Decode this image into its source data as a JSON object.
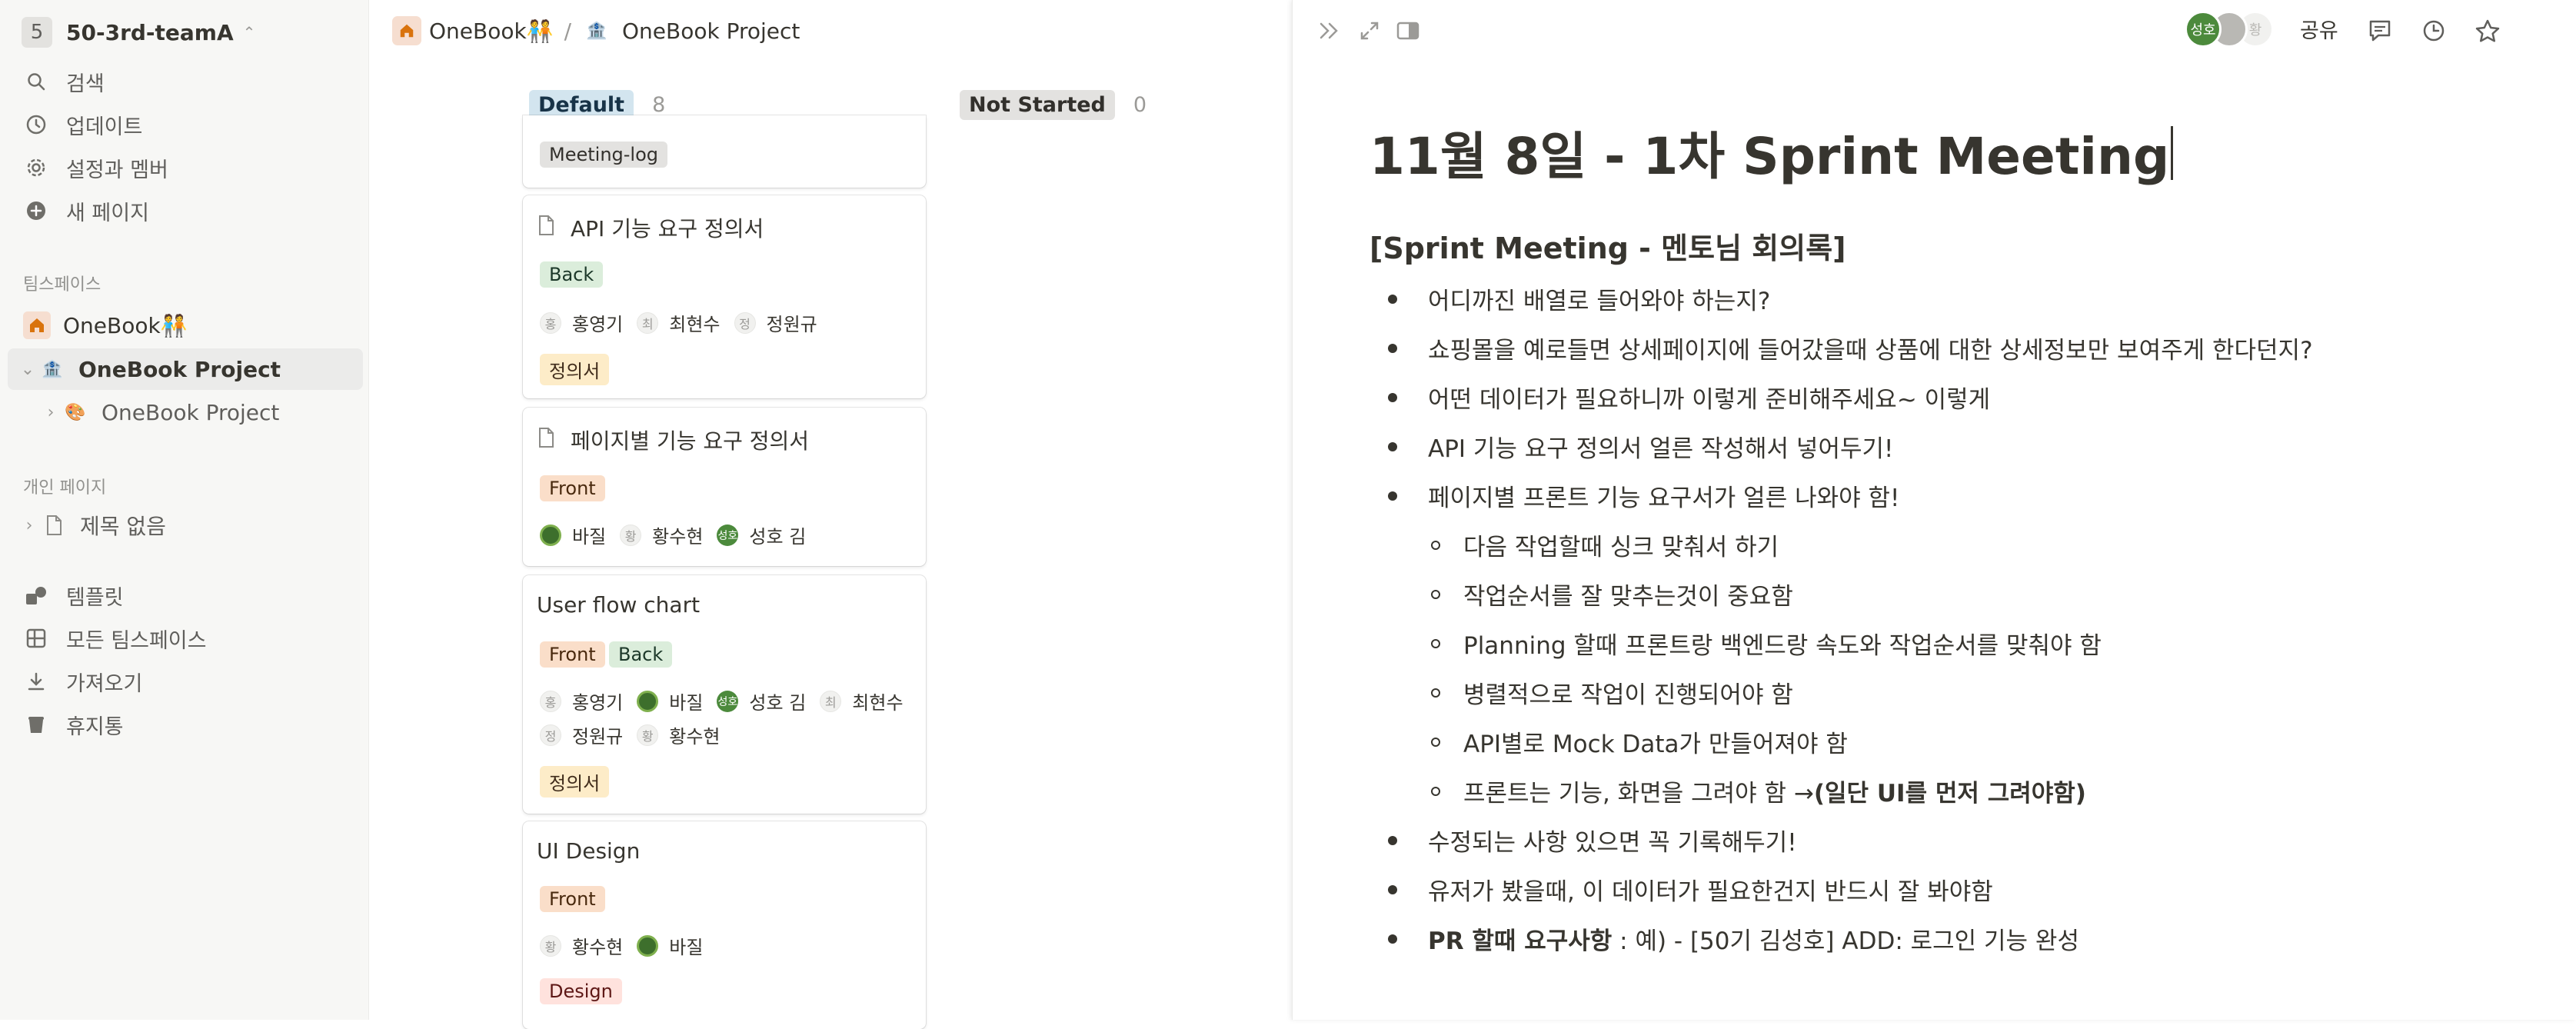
{
  "workspace": {
    "badge": "5",
    "name": "50-3rd-teamA"
  },
  "sidebar": {
    "nav": [
      {
        "label": "검색",
        "icon": "search-icon"
      },
      {
        "label": "업데이트",
        "icon": "clock-icon"
      },
      {
        "label": "설정과 멤버",
        "icon": "gear-icon"
      },
      {
        "label": "새 페이지",
        "icon": "plus-circle-icon"
      }
    ],
    "teamspace_label": "팀스페이스",
    "teamspace_items": [
      {
        "label": "OneBook🧑‍🤝‍🧑",
        "icon": "home-icon"
      },
      {
        "label": "OneBook Project",
        "icon": "bank-emoji"
      },
      {
        "label": "OneBook Project",
        "icon": "palette-emoji"
      }
    ],
    "private_label": "개인 페이지",
    "private_items": [
      {
        "label": "제목 없음",
        "icon": "document-icon"
      }
    ],
    "bottom": [
      {
        "label": "템플릿",
        "icon": "shapes-icon"
      },
      {
        "label": "모든 팀스페이스",
        "icon": "grid-icon"
      },
      {
        "label": "가져오기",
        "icon": "download-icon"
      },
      {
        "label": "휴지통",
        "icon": "trash-icon"
      }
    ]
  },
  "breadcrumb": {
    "first": "OneBook🧑‍🤝‍🧑",
    "sep": "/",
    "second": "OneBook Project"
  },
  "board": {
    "groups": [
      {
        "label": "Default",
        "count": "8",
        "color": "#d3e5ef"
      },
      {
        "label": "Not Started",
        "count": "0",
        "color": "#e3e2e0"
      }
    ],
    "cards": [
      {
        "title": "",
        "tags": [
          "Meeting-log"
        ]
      },
      {
        "title": "API 기능 요구 정의서",
        "tags": [
          "Back"
        ],
        "people": [
          "홍영기",
          "최현수",
          "정원규"
        ],
        "type": "정의서"
      },
      {
        "title": "페이지별 기능 요구 정의서",
        "tags": [
          "Front"
        ],
        "people": [
          "바질",
          "황수현",
          "성호 김"
        ]
      },
      {
        "title": "User flow chart",
        "tags": [
          "Front",
          "Back"
        ],
        "people": [
          "홍영기",
          "바질",
          "성호 김",
          "최현수",
          "정원규",
          "황수현"
        ],
        "type": "정의서"
      },
      {
        "title": "UI Design",
        "tags": [
          "Front"
        ],
        "people": [
          "황수현",
          "바질"
        ],
        "type": "Design"
      }
    ],
    "avatar_letters": {
      "hong": "홍",
      "choi": "최",
      "jeong": "정",
      "hwang": "황",
      "seongho": "성호"
    }
  },
  "peek": {
    "share_label": "공유",
    "avatars": [
      "성호",
      "황"
    ],
    "title": "11월 8일 - 1차 Sprint Meeting",
    "heading": "[Sprint Meeting - 멘토님 회의록]",
    "bullets": [
      "어디까진 배열로 들어와야 하는지?",
      "쇼핑몰을 예로들면 상세페이지에 들어갔을때 상품에 대한 상세정보만 보여주게 한다던지?",
      "어떤 데이터가 필요하니까 이렇게 준비해주세요~ 이렇게",
      "API 기능 요구 정의서 얼른 작성해서 넣어두기!",
      "페이지별 프론트 기능 요구서가 얼른 나와야 함!"
    ],
    "sub_bullets": [
      "다음 작업할때 싱크 맞춰서 하기",
      "작업순서를 잘 맞추는것이 중요함",
      "Planning 할때 프론트랑 백엔드랑 속도와 작업순서를 맞춰야 함",
      "병렬적으로 작업이 진행되어야 함",
      "API별로 Mock Data가 만들어져야 함"
    ],
    "sub_last": {
      "normal": "프론트는 기능, 화면을 그려야 함 → ",
      "bold": "(일단 UI를 먼저 그려야함)"
    },
    "bullets2": [
      "수정되는 사항 있으면 꼭 기록해두기!",
      "유저가 봤을때, 이 데이터가 필요한건지 반드시 잘 봐야함"
    ],
    "pr_line": {
      "bold": "PR 할때 요구사항",
      "rest": " : 예) - [50기 김성호] ADD: 로그인 기능 완성"
    }
  }
}
